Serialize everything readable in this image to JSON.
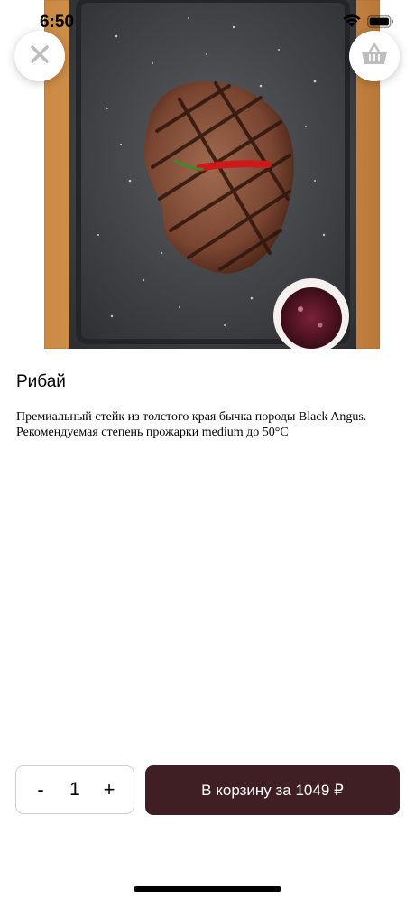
{
  "status_bar": {
    "time": "6:50",
    "wifi_icon": "wifi-icon",
    "battery_icon": "battery-icon"
  },
  "header": {
    "close_icon": "close-icon",
    "cart_icon": "basket-icon"
  },
  "product": {
    "image_icon": "ribeye-steak-photo",
    "title": "Рибай",
    "description": "Премиальный стейк из толстого края бычка породы Black Angus. Рекомендуемая степень прожарки medium до 50°C"
  },
  "quantity": {
    "minus_label": "-",
    "value": "1",
    "plus_label": "+"
  },
  "cart_button": {
    "label": "В корзину за 1049 ₽"
  },
  "colors": {
    "accent": "#3f1f24",
    "border": "#cfcfcf",
    "icon_gray": "#bdbdbd"
  }
}
